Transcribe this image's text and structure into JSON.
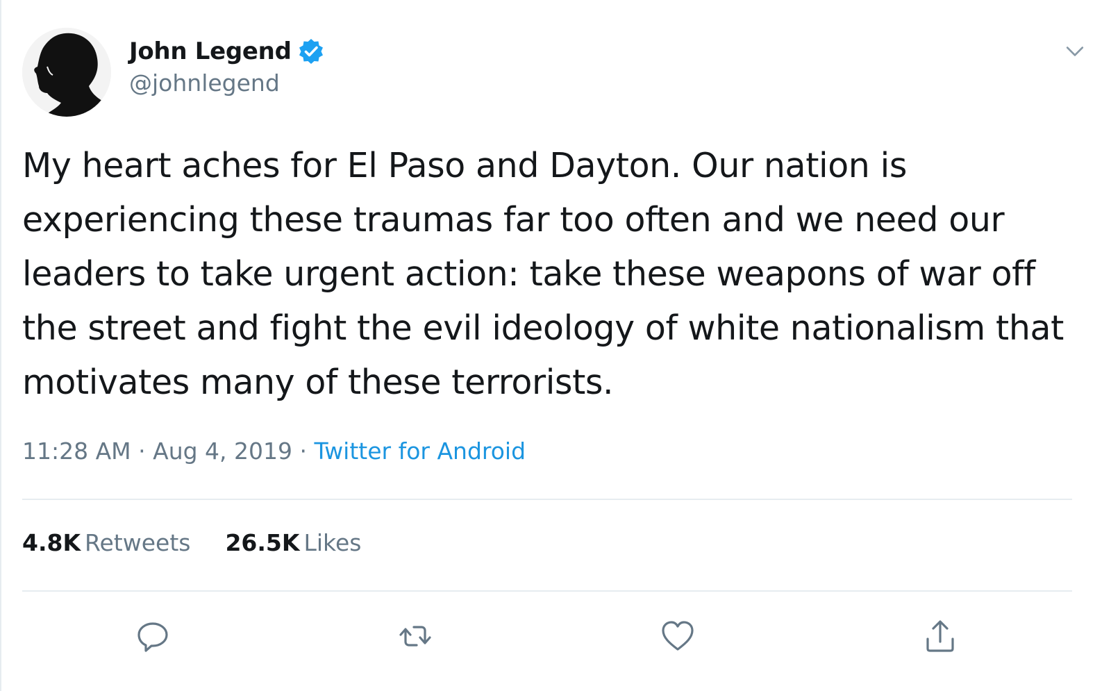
{
  "user": {
    "display_name": "John Legend",
    "handle": "@johnlegend",
    "verified": true
  },
  "tweet": {
    "text": "My heart aches for El Paso and Dayton. Our nation is experiencing these traumas far too often and we need our leaders to take urgent action: take these weapons of war off the street and fight the evil ideology of white nationalism that motivates many of these terrorists.",
    "time": "11:28 AM",
    "separator": " · ",
    "date": "Aug 4, 2019",
    "source": "Twitter for Android"
  },
  "stats": {
    "retweets_count": "4.8K",
    "retweets_label": "Retweets",
    "likes_count": "26.5K",
    "likes_label": "Likes"
  },
  "icons": {
    "verified": "verified-badge-icon",
    "caret": "chevron-down-icon",
    "reply": "reply-icon",
    "retweet": "retweet-icon",
    "like": "heart-icon",
    "share": "share-icon"
  },
  "colors": {
    "text": "#14171a",
    "secondary": "#657786",
    "link": "#1b95e0",
    "verified": "#1da1f2",
    "divider": "#e6ecf0"
  }
}
